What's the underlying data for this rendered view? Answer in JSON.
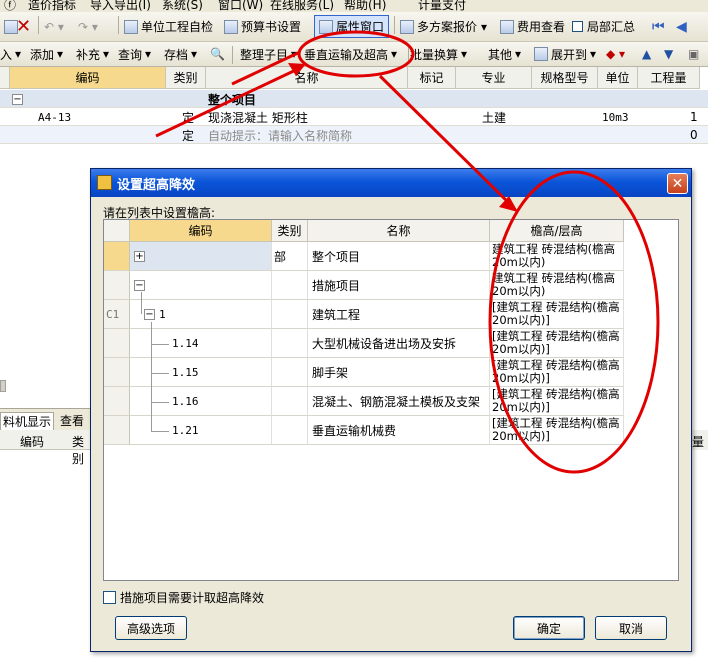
{
  "menubar": {
    "items": [
      "ⓕ",
      "造价指标",
      "导入导出(I)",
      "系统(S)",
      "窗口(W)",
      "在线服务(L)",
      "帮助(H)",
      "计量支付"
    ]
  },
  "toolbar1": {
    "unit_check": "单位工程自检",
    "budget_settings": "预算书设置",
    "property_window": "属性窗口",
    "multi_quote": "多方案报价",
    "cost_view": "费用查看",
    "local_summary": "局部汇总"
  },
  "toolbar2": {
    "import_tail": "入",
    "add": "添加",
    "supplement": "补充",
    "query": "查询",
    "save": "存档",
    "organize": "整理子目",
    "vertical_transport": "垂直运输及超高",
    "batch_convert": "批量换算",
    "other": "其他",
    "expand_to": "展开到"
  },
  "grid": {
    "headers": [
      "编码",
      "类别",
      "名称",
      "标记",
      "专业",
      "规格型号",
      "单位",
      "工程量"
    ],
    "rows": [
      {
        "code": "",
        "type": "",
        "name": "整个项目",
        "mark": "",
        "major": "",
        "spec": "",
        "unit": "",
        "qty": ""
      },
      {
        "code": "A4-13",
        "type": "定",
        "name": "现浇混凝土 矩形柱",
        "mark": "",
        "major": "土建",
        "spec": "",
        "unit": "10m3",
        "qty": "1"
      },
      {
        "code": "",
        "type": "定",
        "name": "自动提示：请输入名称简称",
        "mark": "",
        "major": "",
        "spec": "",
        "unit": "",
        "qty": "0"
      }
    ]
  },
  "bottom": {
    "tab_label": "料机显示",
    "tab2_label": "查看单",
    "col_code": "编码",
    "col_type": "类别",
    "col_right": "量"
  },
  "dialog": {
    "title": "设置超高降效",
    "instruction": "请在列表中设置檐高:",
    "headers": [
      "编码",
      "类别",
      "名称",
      "檐高/层高"
    ],
    "rows": [
      {
        "idx": "",
        "code": "",
        "type": "部",
        "name": "整个项目",
        "height": "建筑工程 砖混结构(檐高20m以内)"
      },
      {
        "idx": "",
        "code": "",
        "type": "",
        "name": "措施项目",
        "height": "建筑工程 砖混结构(檐高20m以内)"
      },
      {
        "idx": "C1",
        "code": "1",
        "type": "",
        "name": "建筑工程",
        "height": "[建筑工程 砖混结构(檐高20m以内)]"
      },
      {
        "idx": "",
        "code": "1.14",
        "type": "",
        "name": "大型机械设备进出场及安拆",
        "height": "[建筑工程 砖混结构(檐高20m以内)]"
      },
      {
        "idx": "",
        "code": "1.15",
        "type": "",
        "name": "脚手架",
        "height": "[建筑工程 砖混结构(檐高20m以内)]"
      },
      {
        "idx": "",
        "code": "1.16",
        "type": "",
        "name": "混凝土、钢筋混凝土模板及支架",
        "height": "[建筑工程 砖混结构(檐高20m以内)]"
      },
      {
        "idx": "",
        "code": "1.21",
        "type": "",
        "name": "垂直运输机械费",
        "height": "[建筑工程 砖混结构(檐高20m以内)]"
      }
    ],
    "checkbox_label": "措施项目需要计取超高降效",
    "advanced_button": "高级选项",
    "ok_button": "确定",
    "cancel_button": "取消",
    "close_glyph": "✕"
  },
  "colors": {
    "title_bar": "#0b55d9",
    "selected_header": "#f7d98d",
    "annotation_red": "#e00000"
  }
}
